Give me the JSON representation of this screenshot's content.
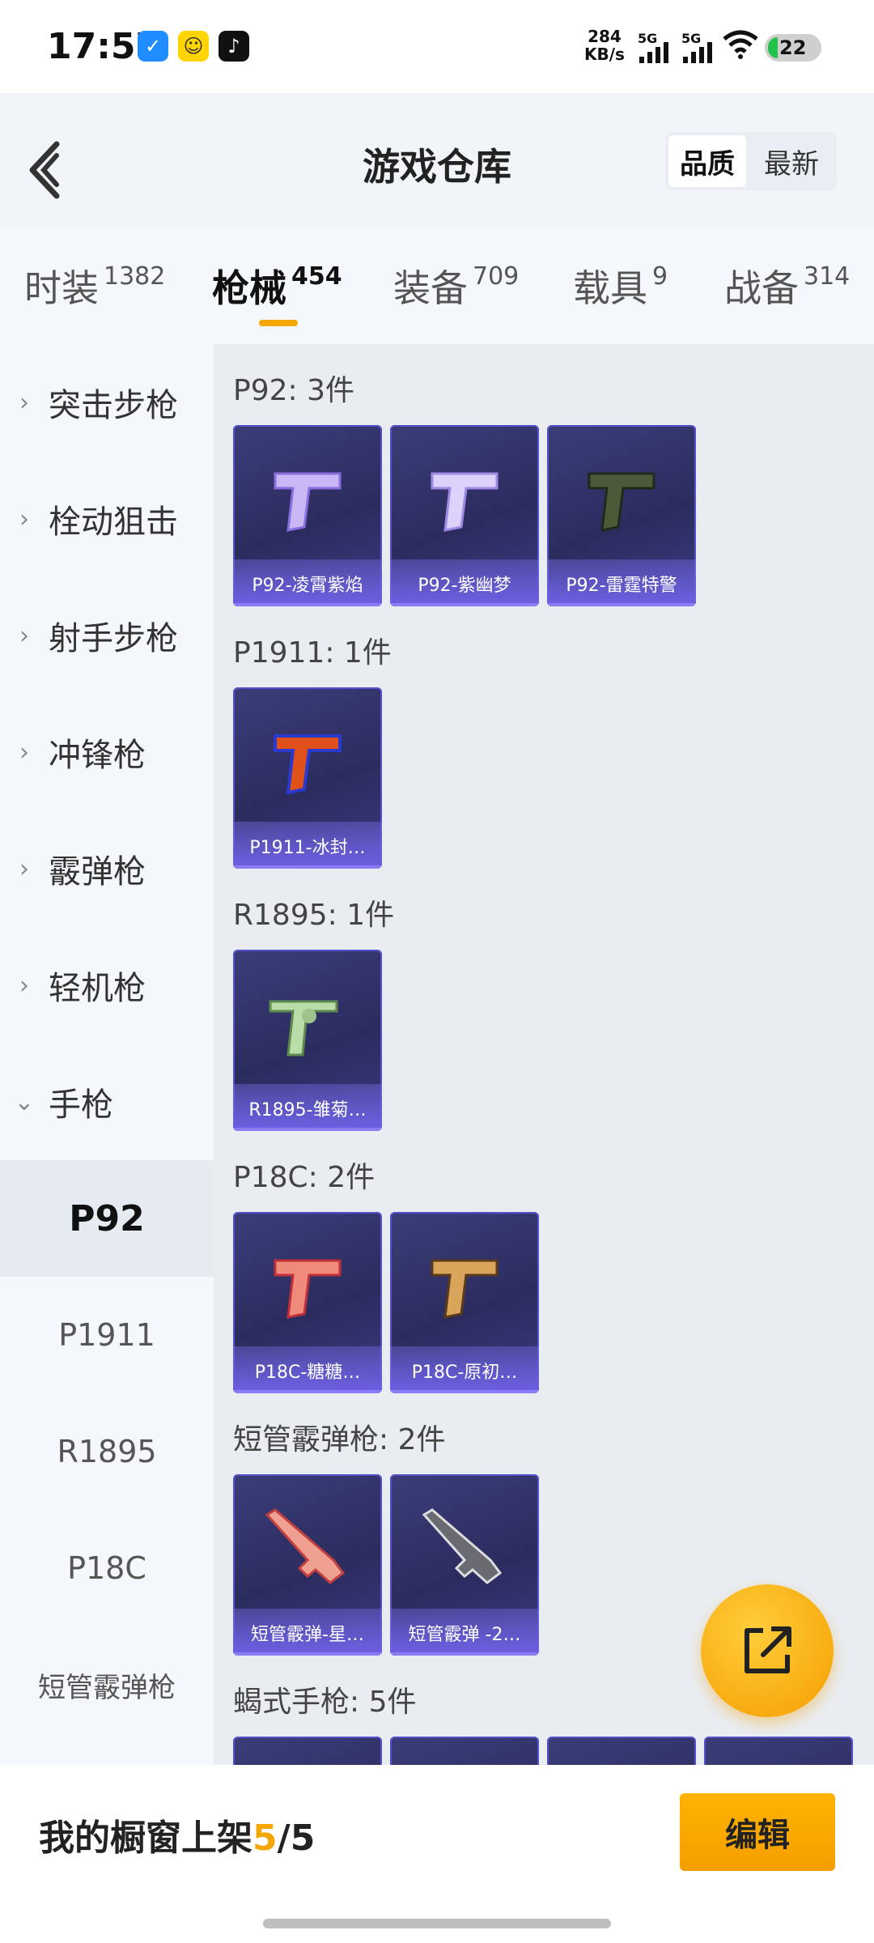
{
  "status_bar": {
    "time": "17:57",
    "net_speed_value": "284",
    "net_speed_unit": "KB/s",
    "sim1": "5G",
    "sim2": "5G",
    "battery": "22"
  },
  "header": {
    "title": "游戏仓库",
    "sort_options": [
      "品质",
      "最新"
    ],
    "sort_selected": "品质"
  },
  "tabs": [
    {
      "label": "时装",
      "count": "1382"
    },
    {
      "label": "枪械",
      "count": "454"
    },
    {
      "label": "装备",
      "count": "709"
    },
    {
      "label": "载具",
      "count": "9"
    },
    {
      "label": "战备",
      "count": "314"
    }
  ],
  "active_tab": "枪械",
  "sidebar": {
    "categories": [
      "突击步枪",
      "栓动狙击",
      "射手步枪",
      "冲锋枪",
      "霰弹枪",
      "轻机枪",
      "手枪"
    ],
    "expanded": "手枪",
    "subitems": [
      "P92",
      "P1911",
      "R1895",
      "P18C",
      "短管霰弹枪"
    ],
    "selected_sub": "P92"
  },
  "groups": [
    {
      "label": "P92: 3件",
      "items": [
        "P92-凌霄紫焰",
        "P92-紫幽梦",
        "P92-雷霆特警"
      ]
    },
    {
      "label": "P1911: 1件",
      "items": [
        "P1911-冰封…"
      ]
    },
    {
      "label": "R1895: 1件",
      "items": [
        "R1895-雏菊…"
      ]
    },
    {
      "label": "P18C: 2件",
      "items": [
        "P18C-糖糖…",
        "P18C-原初…"
      ]
    },
    {
      "label": "短管霰弹枪: 2件",
      "items": [
        "短管霰弹-星…",
        "短管霰弹 -2…"
      ]
    },
    {
      "label": "蝎式手枪: 5件",
      "items": []
    }
  ],
  "bottom": {
    "showcase_prefix": "我的橱窗上架",
    "showcase_count": "5",
    "showcase_total": "/5",
    "edit_label": "编辑"
  },
  "colors": {
    "accent": "#f5a700",
    "card_bg": "#2b2c5e",
    "card_border": "#5552c9"
  }
}
